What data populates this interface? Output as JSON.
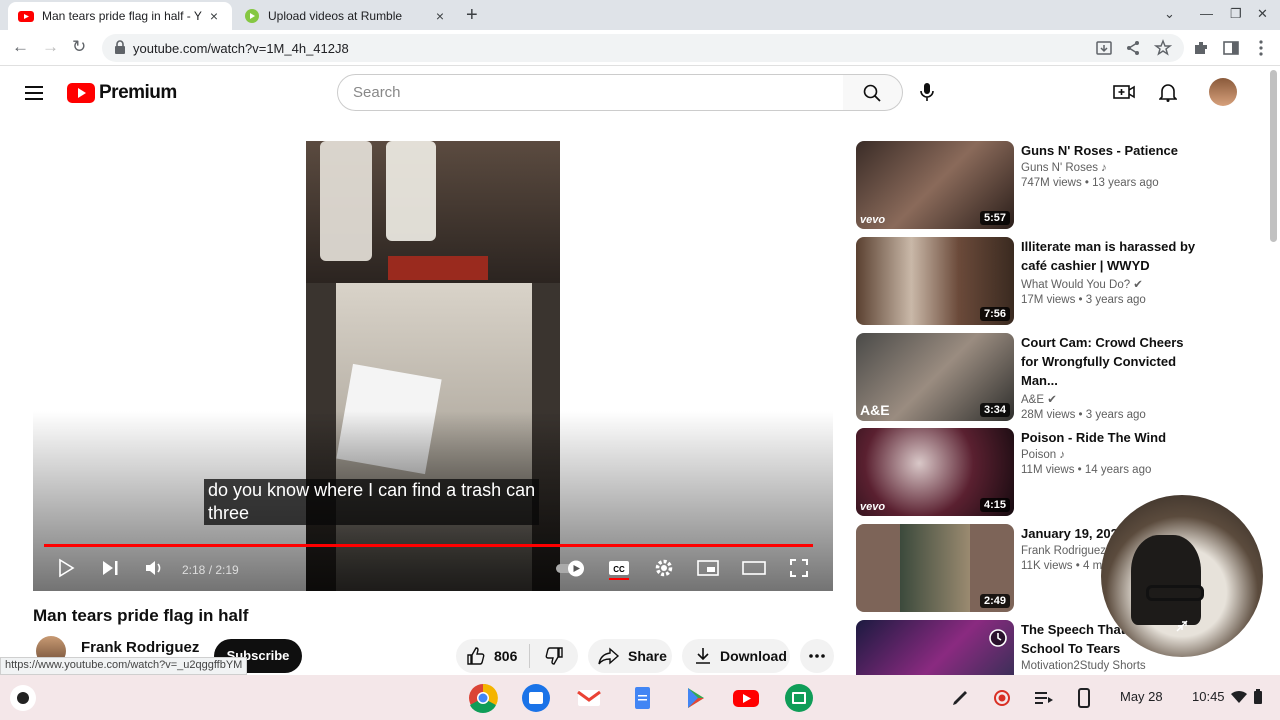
{
  "browser": {
    "tabs": [
      {
        "title": "Man ​tears pride flag in half - Y",
        "close": "×"
      },
      {
        "title": "Upload videos at Rumble",
        "close": "×"
      }
    ],
    "new_tab": "+",
    "url": "youtube.com/watch?v=1M_4h_412J8"
  },
  "youtube": {
    "brand": "Premium",
    "search_placeholder": "Search"
  },
  "video": {
    "caption_line1": "do you know where I can find a trash can",
    "caption_line2": "three",
    "time": "2:18 / 2:19",
    "progress": 0.993,
    "title": "Man ​tears pride flag in half",
    "channel": "Frank Rodriguez",
    "subscribe": "Subscribe",
    "likes": "806",
    "share": "Share",
    "download": "Download",
    "status_url": "https://www.youtube.com/watch?v=_u2qggffbYM"
  },
  "recommendations": [
    {
      "title": "Guns N' Roses - Patience",
      "channel": "Guns N' Roses ♪",
      "meta": "747M views • 13 years ago",
      "duration": "5:57",
      "badge": "vevo"
    },
    {
      "title": "Illiterate man is harassed by café cashier | WWYD",
      "channel": "What Would You Do? ✔",
      "meta": "17M views • 3 years ago",
      "duration": "7:56",
      "badge": ""
    },
    {
      "title": "Court Cam: Crowd Cheers for Wrongfully Convicted Man...",
      "channel": "A&E ✔",
      "meta": "28M views • 3 years ago",
      "duration": "3:34",
      "badge": "A&E"
    },
    {
      "title": "Poison - Ride The Wind",
      "channel": "Poison ♪",
      "meta": "11M views • 14 years ago",
      "duration": "4:15",
      "badge": "vevo"
    },
    {
      "title": "January 19, 202",
      "channel": "Frank Rodriguez",
      "meta": "11K views • 4 m",
      "duration": "2:49",
      "badge": ""
    },
    {
      "title": "The Speech That ... Entire School To Tears",
      "channel": "Motivation2Study Shorts",
      "meta": "",
      "duration": "",
      "badge": ""
    }
  ],
  "shelf": {
    "date": "May 28",
    "time": "10:45"
  }
}
